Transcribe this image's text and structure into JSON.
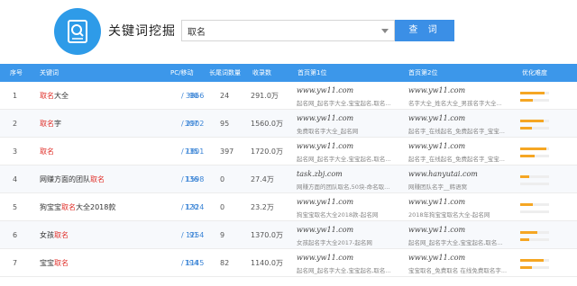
{
  "header": {
    "title": "关键词挖掘",
    "search_value": "取名",
    "search_button": "查 词"
  },
  "table": {
    "columns": [
      "序号",
      "关键词",
      "PC/移动",
      "长尾词数量",
      "收录数",
      "首页第1位",
      "首页第2位",
      "优化难度"
    ],
    "rows": [
      {
        "idx": "1",
        "kw_pre": "",
        "kw_hl": "取名",
        "kw_post": "大全",
        "pc": "90",
        "mobile": "3866",
        "longtail": "24",
        "results": "291.0万",
        "site1": "www.yw11.com",
        "title1": "起名网_起名字大全,宝宝起名,取名...",
        "site2": "www.yw11.com",
        "title2": "名字大全_姓名大全_男孩名字大全...",
        "difficulty": 0.85,
        "difficulty2": 0.45
      },
      {
        "idx": "2",
        "kw_pre": "",
        "kw_hl": "取名",
        "kw_post": "字",
        "pc": "307",
        "mobile": "2902",
        "longtail": "95",
        "results": "1560.0万",
        "site1": "www.yw11.com",
        "title1": "免费取名字大全_起名网",
        "site2": "www.yw11.com",
        "title2": "起名字_在线起名_免费起名字_宝宝...",
        "difficulty": 0.8,
        "difficulty2": 0.4
      },
      {
        "idx": "3",
        "kw_pre": "",
        "kw_hl": "取名",
        "kw_post": "",
        "pc": "735",
        "mobile": "1801",
        "longtail": "397",
        "results": "1720.0万",
        "site1": "www.yw11.com",
        "title1": "起名网_起名字大全,宝宝起名,取名...",
        "site2": "www.yw11.com",
        "title2": "起名字_在线起名_免费起名字_宝宝...",
        "difficulty": 0.9,
        "difficulty2": 0.5
      },
      {
        "idx": "4",
        "kw_pre": "网赚方面的团队",
        "kw_hl": "取名",
        "kw_post": "",
        "pc": "136",
        "mobile": "1598",
        "longtail": "0",
        "results": "27.4万",
        "site1": "task.zbj.com",
        "title1": "网赚方面的团队取名,50块-命名取...",
        "site2": "www.hanyutai.com",
        "title2": "网赚团队名字__韩语窝",
        "difficulty": 0.3,
        "difficulty2": 0.0
      },
      {
        "idx": "5",
        "kw_pre": "狗宝宝",
        "kw_hl": "取名",
        "kw_post": "大全2018款",
        "pc": "120",
        "mobile": "1324",
        "longtail": "0",
        "results": "23.2万",
        "site1": "www.yw11.com",
        "title1": "狗宝宝取名大全2018款-起名网",
        "site2": "www.yw11.com",
        "title2": "2018年狗宝宝取名大全-起名网",
        "difficulty": 0.45,
        "difficulty2": 0.0
      },
      {
        "idx": "6",
        "kw_pre": "女孩",
        "kw_hl": "取名",
        "kw_post": "",
        "pc": "91",
        "mobile": "1254",
        "longtail": "9",
        "results": "1370.0万",
        "site1": "www.yw11.com",
        "title1": "女孩起名字大全2017-起名网",
        "site2": "www.yw11.com",
        "title2": "起名网_起名字大全,宝宝起名,取名...",
        "difficulty": 0.6,
        "difficulty2": 0.3
      },
      {
        "idx": "7",
        "kw_pre": "宝宝",
        "kw_hl": "取名",
        "kw_post": "",
        "pc": "194",
        "mobile": "1145",
        "longtail": "82",
        "results": "1140.0万",
        "site1": "www.yw11.com",
        "title1": "起名网_起名字大全,宝宝起名,取名...",
        "site2": "www.yw11.com",
        "title2": "宝宝取名_免费取名 在线免费取名字...",
        "difficulty": 0.8,
        "difficulty2": 0.4
      }
    ]
  },
  "colors": {
    "accent": "#3c97ea",
    "highlight": "#e0302a",
    "difficulty": "#f5a623"
  },
  "icons": {
    "logo": "search-document-icon",
    "dropdown": "chevron-down-icon"
  }
}
